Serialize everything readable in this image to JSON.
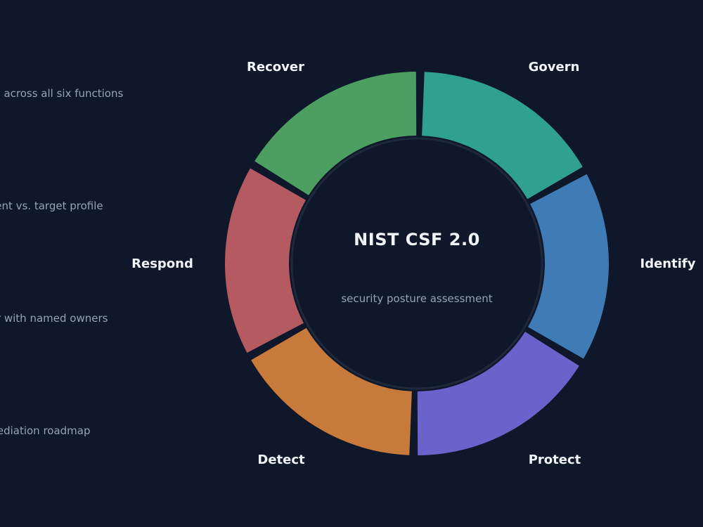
{
  "center": {
    "title": "NIST CSF 2.0",
    "subtitle": "security posture assessment"
  },
  "functions": [
    {
      "name": "Govern",
      "color": "#2ea192"
    },
    {
      "name": "Identify",
      "color": "#3f7cb6"
    },
    {
      "name": "Protect",
      "color": "#6b63cc"
    },
    {
      "name": "Detect",
      "color": "#c87a3a"
    },
    {
      "name": "Respond",
      "color": "#b55a60"
    },
    {
      "name": "Recover",
      "color": "#4c9e61"
    }
  ],
  "side_notes": [
    "ysis across all six functions",
    "urrent vs. target profile",
    "ster with named owners",
    "emediation roadmap"
  ],
  "colors": {
    "background": "#0f172a",
    "inner_ring": "#1e293b"
  }
}
